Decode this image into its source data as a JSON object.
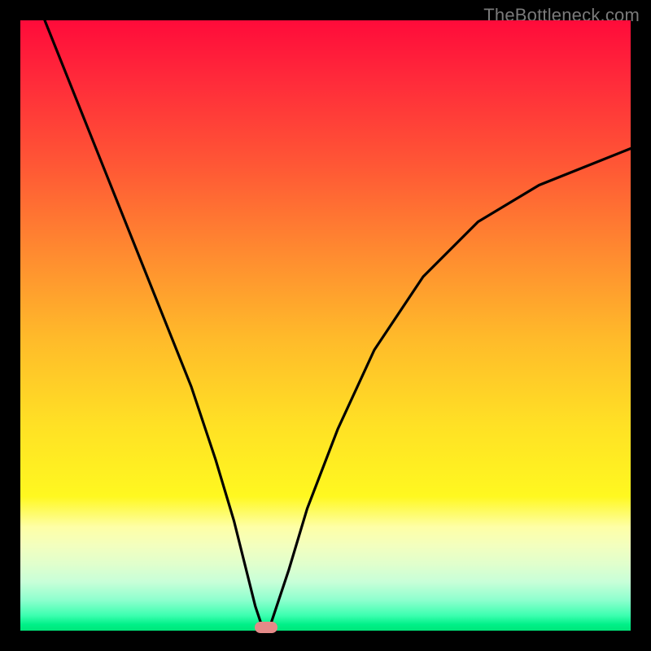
{
  "watermark": "TheBottleneck.com",
  "chart_data": {
    "type": "line",
    "title": "",
    "xlabel": "",
    "ylabel": "",
    "xlim": [
      0,
      100
    ],
    "ylim": [
      0,
      100
    ],
    "series": [
      {
        "name": "bottleneck-curve",
        "x": [
          4,
          10,
          16,
          22,
          28,
          32,
          35,
          37,
          38.5,
          39.5,
          40.2,
          41,
          42,
          44,
          47,
          52,
          58,
          66,
          75,
          85,
          95,
          100
        ],
        "values": [
          100,
          85,
          70,
          55,
          40,
          28,
          18,
          10,
          4,
          1,
          0,
          1,
          4,
          10,
          20,
          33,
          46,
          58,
          67,
          73,
          77,
          79
        ]
      }
    ],
    "marker": {
      "x": 40.2,
      "y": 0.5,
      "label": "optimal-point"
    },
    "gradient_note": "vertical red-to-green heatmap background"
  },
  "colors": {
    "curve": "#000000",
    "marker": "#e48a88",
    "frame": "#000000"
  }
}
